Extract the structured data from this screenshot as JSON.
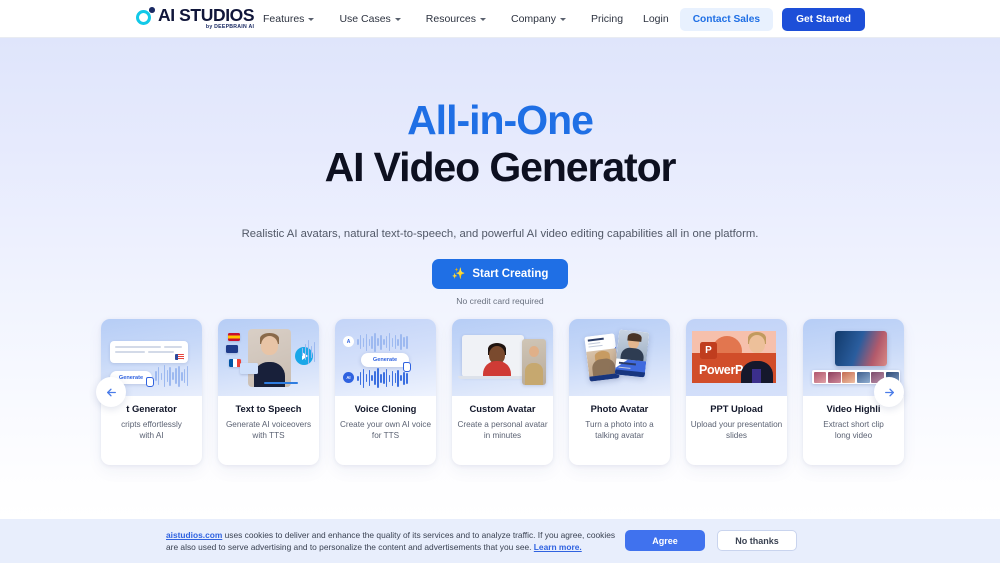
{
  "header": {
    "logo": {
      "title": "AI STUDIOS",
      "subtitle": "by DEEPBRAIN AI"
    },
    "nav": [
      {
        "label": "Features",
        "has_caret": true
      },
      {
        "label": "Use Cases",
        "has_caret": true
      },
      {
        "label": "Resources",
        "has_caret": true
      },
      {
        "label": "Company",
        "has_caret": true
      },
      {
        "label": "Pricing",
        "has_caret": false
      }
    ],
    "login_label": "Login",
    "contact_sales_label": "Contact Sales",
    "get_started_label": "Get Started"
  },
  "hero": {
    "headline_line1": "All-in-One",
    "headline_line2": "AI Video Generator",
    "subheadline": "Realistic AI avatars, natural text-to-speech, and powerful AI video editing capabilities all in one platform.",
    "cta_label": "Start Creating",
    "cta_note": "No credit card required",
    "accent_color": "#1f6fe5"
  },
  "carousel": {
    "prev_label": "Previous",
    "next_label": "Next",
    "cards": [
      {
        "title": "t Generator",
        "desc_line1": "cripts effortlessly",
        "desc_line2": "with AI",
        "media_label": "Generate"
      },
      {
        "title": "Text to Speech",
        "desc_line1": "Generate AI voiceovers",
        "desc_line2": "with TTS"
      },
      {
        "title": "Voice Cloning",
        "desc_line1": "Create your own AI voice",
        "desc_line2": "for TTS",
        "media_label": "Generate",
        "badge_user": "A",
        "badge_ai": "AI"
      },
      {
        "title": "Custom Avatar",
        "desc_line1": "Create a personal avatar",
        "desc_line2": "in minutes"
      },
      {
        "title": "Photo Avatar",
        "desc_line1": "Turn a photo into a",
        "desc_line2": "talking avatar"
      },
      {
        "title": "PPT Upload",
        "desc_line1": "Upload your presentation",
        "desc_line2": "slides",
        "media_label": "PowerP",
        "media_badge": "P"
      },
      {
        "title": "Video Highli",
        "desc_line1": "Extract short clip",
        "desc_line2": "long video"
      }
    ]
  },
  "cookie_banner": {
    "site_link": "aistudios.com",
    "text_part1": " uses cookies to deliver and enhance the quality of its services and to analyze traffic. If you agree, cookies are also used to serve advertising and to personalize the content and advertisements that you see. ",
    "learn_more": "Learn more.",
    "agree_label": "Agree",
    "decline_label": "No thanks"
  }
}
